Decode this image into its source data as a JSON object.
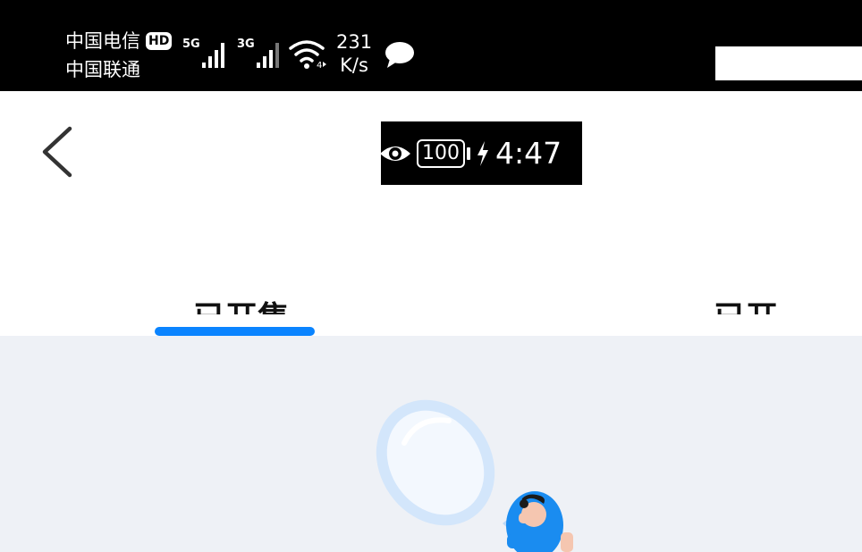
{
  "status_bar": {
    "carrier_1": "中国电信",
    "hd_label": "HD",
    "carrier_2": "中国联通",
    "signal_1_gen": "5G",
    "signal_2_gen": "3G",
    "speed_value": "231",
    "speed_unit": "K/s"
  },
  "overlay_status": {
    "battery_level": "100",
    "time": "4:47"
  },
  "tabs": [
    {
      "label": "已开售课"
    },
    {
      "label": "已开"
    }
  ],
  "colors": {
    "accent": "#0a84ff",
    "content_bg": "#eef1f6"
  }
}
